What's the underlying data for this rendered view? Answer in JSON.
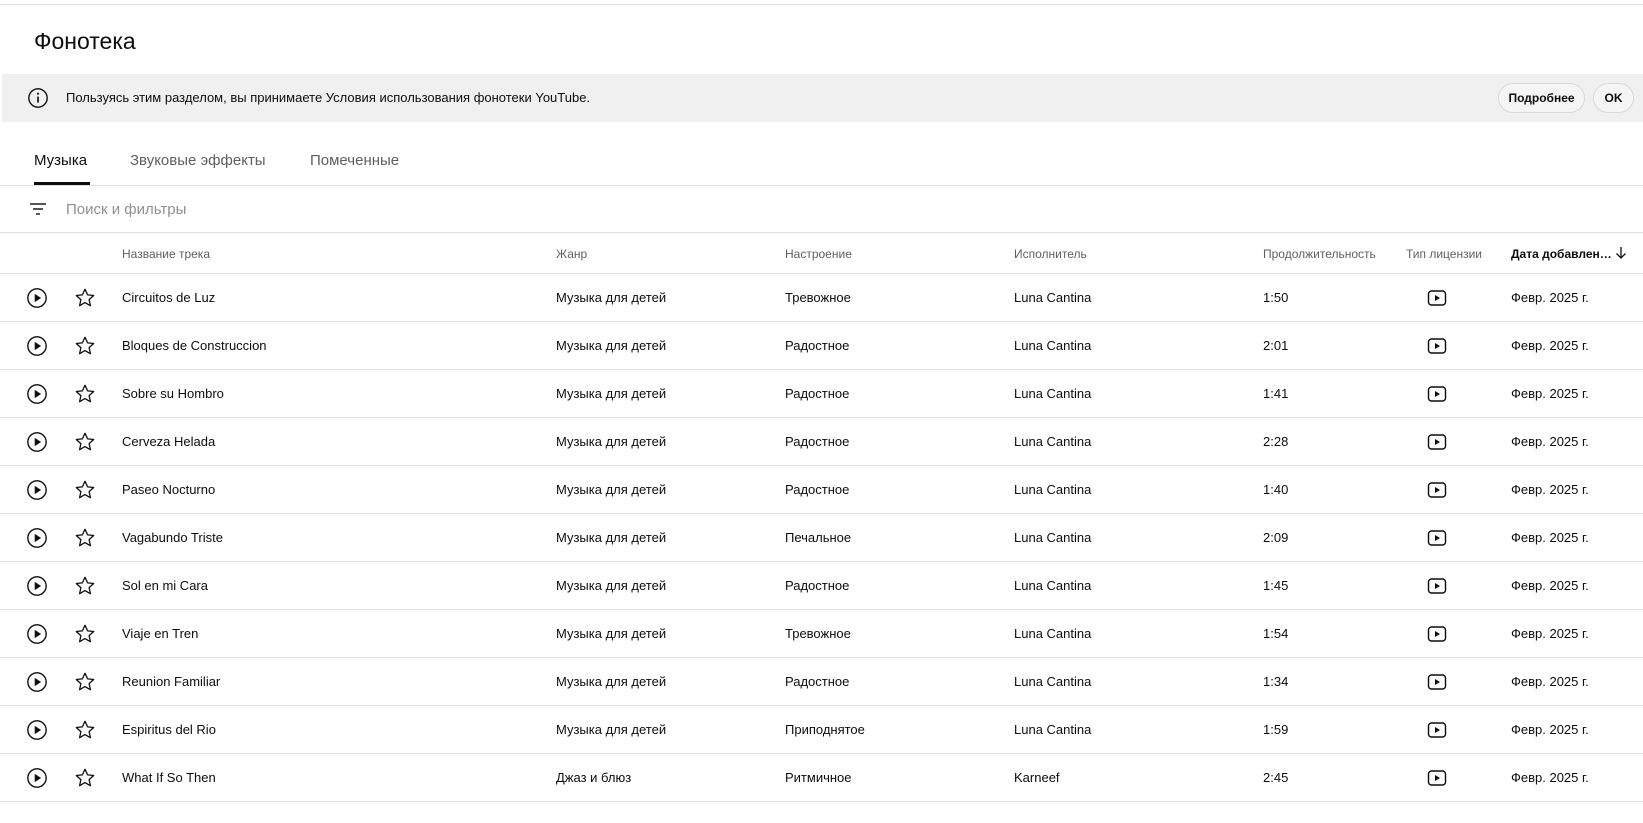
{
  "page": {
    "title": "Фонотека"
  },
  "banner": {
    "message": "Пользуясь этим разделом, вы принимаете Условия использования фонотеки YouTube.",
    "more_label": "Подробнее",
    "ok_label": "OK",
    "icon": "info-icon"
  },
  "tabs": [
    {
      "label": "Музыка",
      "active": true
    },
    {
      "label": "Звуковые эффекты",
      "active": false
    },
    {
      "label": "Помеченные",
      "active": false
    }
  ],
  "filter": {
    "placeholder": "Поиск и фильтры",
    "icon": "filter-icon"
  },
  "table": {
    "headers": {
      "title": "Название трека",
      "genre": "Жанр",
      "mood": "Настроение",
      "artist": "Исполнитель",
      "duration": "Продолжительность",
      "license": "Тип лицензии",
      "date": "Дата добавлен…"
    },
    "sorted_by": "date",
    "sort_direction": "desc",
    "rows": [
      {
        "title": "Circuitos de Luz",
        "genre": "Музыка для детей",
        "mood": "Тревожное",
        "artist": "Luna Cantina",
        "duration": "1:50",
        "date": "Февр. 2025 г."
      },
      {
        "title": "Bloques de Construccion",
        "genre": "Музыка для детей",
        "mood": "Радостное",
        "artist": "Luna Cantina",
        "duration": "2:01",
        "date": "Февр. 2025 г."
      },
      {
        "title": "Sobre su Hombro",
        "genre": "Музыка для детей",
        "mood": "Радостное",
        "artist": "Luna Cantina",
        "duration": "1:41",
        "date": "Февр. 2025 г."
      },
      {
        "title": "Cerveza Helada",
        "genre": "Музыка для детей",
        "mood": "Радостное",
        "artist": "Luna Cantina",
        "duration": "2:28",
        "date": "Февр. 2025 г."
      },
      {
        "title": "Paseo Nocturno",
        "genre": "Музыка для детей",
        "mood": "Радостное",
        "artist": "Luna Cantina",
        "duration": "1:40",
        "date": "Февр. 2025 г."
      },
      {
        "title": "Vagabundo Triste",
        "genre": "Музыка для детей",
        "mood": "Печальное",
        "artist": "Luna Cantina",
        "duration": "2:09",
        "date": "Февр. 2025 г."
      },
      {
        "title": "Sol en mi Cara",
        "genre": "Музыка для детей",
        "mood": "Радостное",
        "artist": "Luna Cantina",
        "duration": "1:45",
        "date": "Февр. 2025 г."
      },
      {
        "title": "Viaje en Tren",
        "genre": "Музыка для детей",
        "mood": "Тревожное",
        "artist": "Luna Cantina",
        "duration": "1:54",
        "date": "Февр. 2025 г."
      },
      {
        "title": "Reunion Familiar",
        "genre": "Музыка для детей",
        "mood": "Радостное",
        "artist": "Luna Cantina",
        "duration": "1:34",
        "date": "Февр. 2025 г."
      },
      {
        "title": "Espiritus del Rio",
        "genre": "Музыка для детей",
        "mood": "Приподнятое",
        "artist": "Luna Cantina",
        "duration": "1:59",
        "date": "Февр. 2025 г."
      },
      {
        "title": "What If So Then",
        "genre": "Джаз и блюз",
        "mood": "Ритмичное",
        "artist": "Karneef",
        "duration": "2:45",
        "date": "Февр. 2025 г."
      }
    ]
  }
}
